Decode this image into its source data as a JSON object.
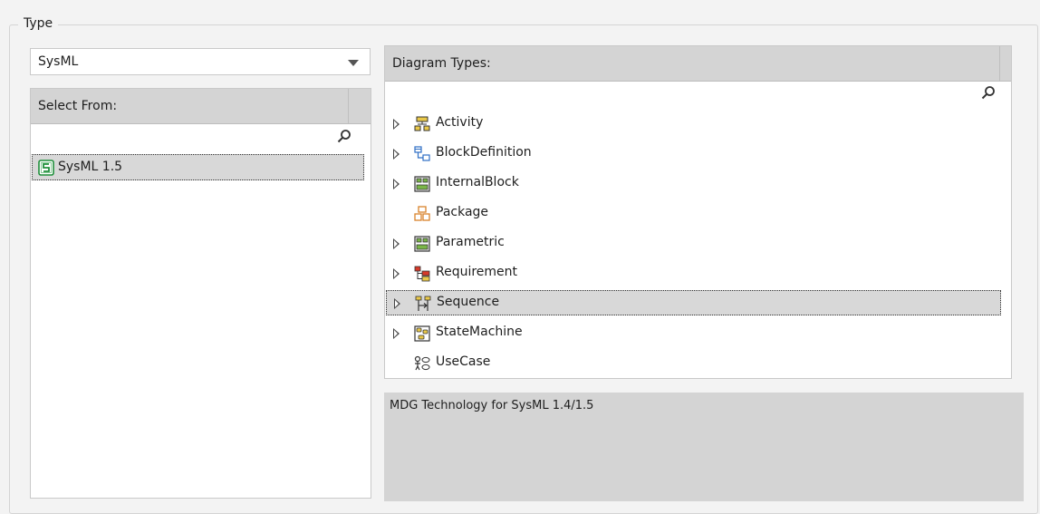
{
  "group": {
    "title": "Type"
  },
  "type_select": {
    "value": "SysML"
  },
  "select_from": {
    "header": "Select From:",
    "items": [
      {
        "label": "SysML 1.5",
        "icon": "sysml-profile-icon",
        "selected": true
      }
    ]
  },
  "diagram_types": {
    "header": "Diagram Types:",
    "items": [
      {
        "label": "Activity",
        "icon": "activity-diagram-icon",
        "expandable": true,
        "selected": false
      },
      {
        "label": "BlockDefinition",
        "icon": "block-definition-icon",
        "expandable": true,
        "selected": false
      },
      {
        "label": "InternalBlock",
        "icon": "internal-block-icon",
        "expandable": true,
        "selected": false
      },
      {
        "label": "Package",
        "icon": "package-icon",
        "expandable": false,
        "selected": false
      },
      {
        "label": "Parametric",
        "icon": "parametric-icon",
        "expandable": true,
        "selected": false
      },
      {
        "label": "Requirement",
        "icon": "requirement-icon",
        "expandable": true,
        "selected": false
      },
      {
        "label": "Sequence",
        "icon": "sequence-diagram-icon",
        "expandable": true,
        "selected": true
      },
      {
        "label": "StateMachine",
        "icon": "state-machine-icon",
        "expandable": true,
        "selected": false
      },
      {
        "label": "UseCase",
        "icon": "use-case-icon",
        "expandable": false,
        "selected": false
      }
    ]
  },
  "description": {
    "text": "MDG Technology for SysML 1.4/1.5"
  },
  "colors": {
    "selection": "#d8d8d8",
    "header": "#d4d4d4",
    "background": "#f3f3f3"
  }
}
